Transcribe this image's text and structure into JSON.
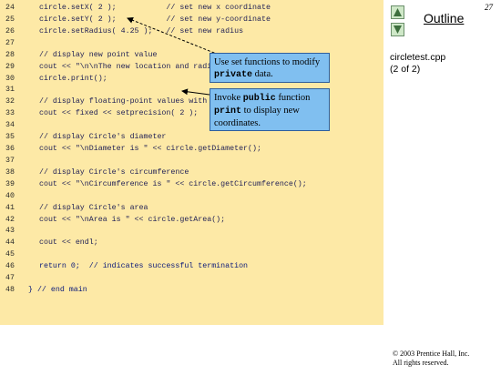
{
  "page_number": "27",
  "outline": {
    "title": "Outline"
  },
  "file": {
    "name": "circletest.cpp",
    "part": "(2 of 2)"
  },
  "code_lines": [
    {
      "num": "24",
      "code": "circle.setX( 2 );           // set new x coordinate"
    },
    {
      "num": "25",
      "code": "circle.setY( 2 );           // set new y-coordinate"
    },
    {
      "num": "26",
      "code": "circle.setRadius( 4.25 );   // set new radius"
    },
    {
      "num": "27",
      "code": ""
    },
    {
      "num": "28",
      "code": "// display new point value"
    },
    {
      "num": "29",
      "code": "cout << \"\\n\\nThe new location and radius of circle are\\n\""
    },
    {
      "num": "30",
      "code": "circle.print();"
    },
    {
      "num": "31",
      "code": ""
    },
    {
      "num": "32",
      "code": "// display floating-point values with 2 digits of precision"
    },
    {
      "num": "33",
      "code": "cout << fixed << setprecision( 2 );"
    },
    {
      "num": "34",
      "code": ""
    },
    {
      "num": "35",
      "code": "// display Circle's diameter"
    },
    {
      "num": "36",
      "code": "cout << \"\\nDiameter is \" << circle.getDiameter();"
    },
    {
      "num": "37",
      "code": ""
    },
    {
      "num": "38",
      "code": "// display Circle's circumference"
    },
    {
      "num": "39",
      "code": "cout << \"\\nCircumference is \" << circle.getCircumference();"
    },
    {
      "num": "40",
      "code": ""
    },
    {
      "num": "41",
      "code": "// display Circle's area"
    },
    {
      "num": "42",
      "code": "cout << \"\\nArea is \" << circle.getArea();"
    },
    {
      "num": "43",
      "code": ""
    },
    {
      "num": "44",
      "code": "cout << endl;"
    },
    {
      "num": "45",
      "code": ""
    },
    {
      "num": "46",
      "code": "return 0;  // indicates successful termination"
    },
    {
      "num": "47",
      "code": ""
    },
    {
      "num": "48",
      "code": "} // end main"
    }
  ],
  "callouts": {
    "first": {
      "before": "Use set functions to modify ",
      "mono": "private",
      "after": " data."
    },
    "second": {
      "before": "Invoke ",
      "mono1": "public",
      "middle": " function ",
      "mono2": "print",
      "after": " to display new coordinates."
    }
  },
  "copyright": {
    "line1": "© 2003 Prentice Hall, Inc.",
    "line2": "All rights reserved."
  },
  "icons": {
    "up": "triangle-up-icon",
    "down": "triangle-down-icon"
  },
  "colors": {
    "code_background": "#fde9a6",
    "callout": "#80bff0",
    "nav_button": "#cfe8c8"
  }
}
